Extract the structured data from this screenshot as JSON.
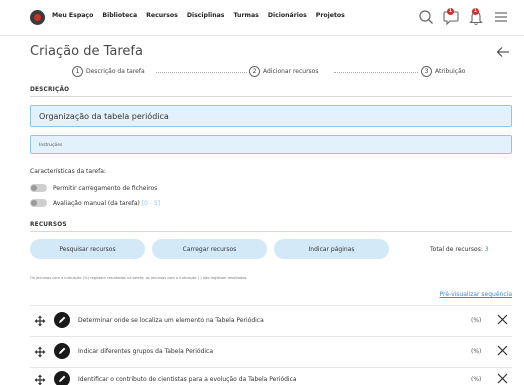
{
  "nav": {
    "items": [
      "Meu Espaço",
      "Biblioteca",
      "Recursos",
      "Disciplinas",
      "Turmas",
      "Dicionários",
      "Projetos"
    ],
    "messages_badge": "1",
    "notifications_badge": "1"
  },
  "page": {
    "title": "Criação de Tarefa"
  },
  "stepper": {
    "steps": [
      {
        "num": "1",
        "label": "Descrição da tarefa"
      },
      {
        "num": "2",
        "label": "Adicionar recursos"
      },
      {
        "num": "3",
        "label": "Atribuição"
      }
    ]
  },
  "descricao": {
    "heading": "DESCRIÇÃO",
    "title_value": "Organização da tabela periódica",
    "instructions_placeholder": "Instruções"
  },
  "caracteristicas": {
    "title": "Características da tarefa:",
    "upload_label": "Permitir carregamento de ficheiros",
    "manual_label": "Avaliação manual (da tarefa)",
    "manual_hint": "[0 - 5]"
  },
  "recursos": {
    "heading": "RECURSOS",
    "search_button": "Pesquisar recursos",
    "upload_button": "Carregar recursos",
    "pages_button": "Indicar páginas",
    "total_label": "Total de recursos:",
    "total_value": "3",
    "note": "Os recursos com a indicação (%) registam resultados na tarefa; os recursos com a indicação ( ) não registam resultados.",
    "preview_link": "Pré-visualizar sequência",
    "items": [
      {
        "label": "Determinar onde se localiza um elemento na Tabela Periódica",
        "pct": "(%)"
      },
      {
        "label": "Indicar diferentes grupos da Tabela Periódica",
        "pct": "(%)"
      },
      {
        "label": "Identificar o contributo de cientistas para a evolução da Tabela Periódica",
        "pct": "(%)"
      }
    ]
  }
}
